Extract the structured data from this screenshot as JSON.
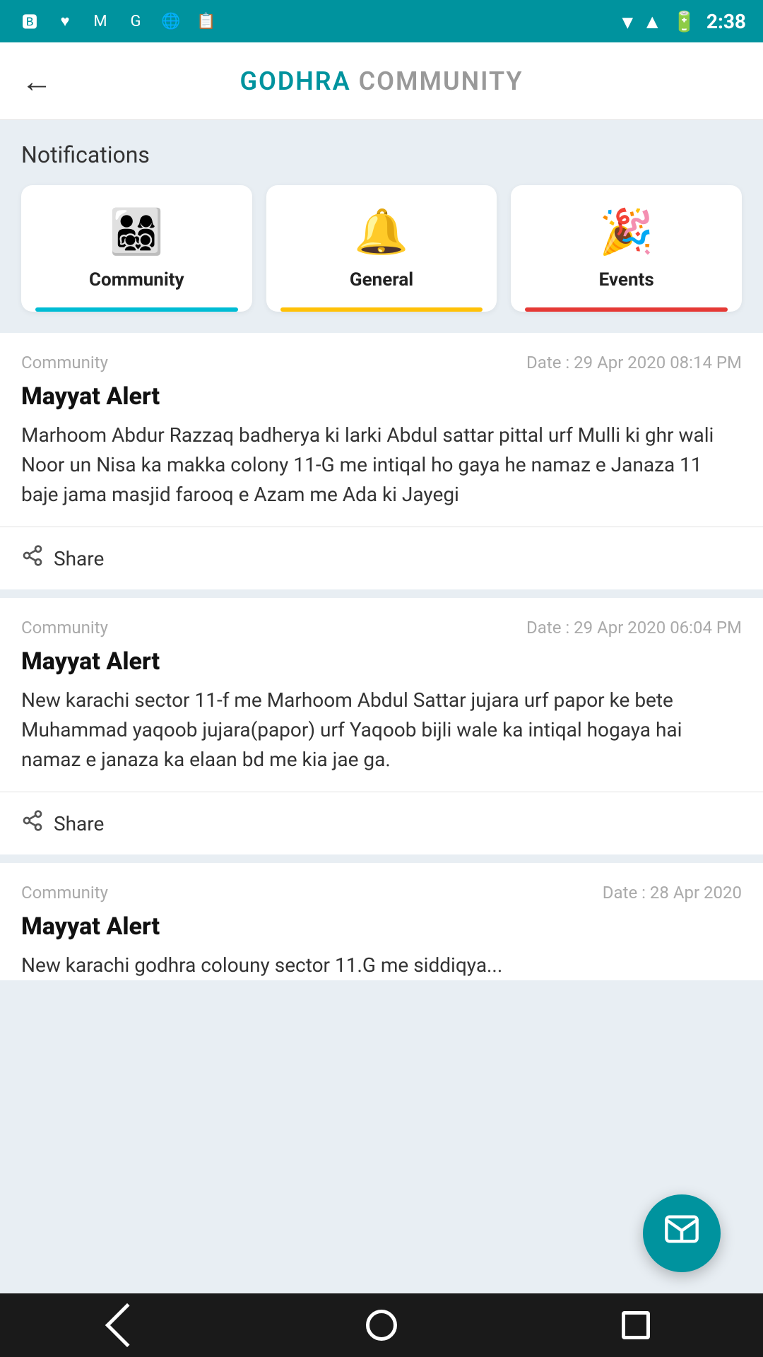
{
  "statusBar": {
    "time": "2:38",
    "icons": [
      "battery",
      "signal",
      "wifi"
    ]
  },
  "header": {
    "brand": "GODHRA",
    "title": " COMMUNITY",
    "backLabel": "←"
  },
  "notifications": {
    "sectionLabel": "Notifications",
    "categories": [
      {
        "id": "community",
        "emoji": "👨‍👧‍👦",
        "label": "Community",
        "indicatorClass": "indicator-teal"
      },
      {
        "id": "general",
        "emoji": "🔔",
        "label": "General",
        "indicatorClass": "indicator-orange"
      },
      {
        "id": "events",
        "emoji": "🎉",
        "label": "Events",
        "indicatorClass": "indicator-red"
      }
    ],
    "items": [
      {
        "category": "Community",
        "date": "Date : 29 Apr 2020 08:14 PM",
        "title": "Mayyat Alert",
        "body": "Marhoom Abdur Razzaq badherya ki larki Abdul sattar pittal urf Mulli ki ghr wali Noor un Nisa ka makka colony 11-G me intiqal ho gaya he namaz e Janaza  11 baje jama masjid farooq e Azam me Ada ki Jayegi",
        "shareLabel": "Share"
      },
      {
        "category": "Community",
        "date": "Date : 29 Apr 2020 06:04 PM",
        "title": "Mayyat Alert",
        "body": " New karachi sector 11-f me Marhoom Abdul Sattar jujara urf papor ke bete Muhammad yaqoob jujara(papor) urf Yaqoob bijli wale ka intiqal hogaya hai namaz e janaza ka elaan bd me kia jae ga.",
        "shareLabel": "Share"
      },
      {
        "category": "Community",
        "date": "Date : 28 Apr 2020",
        "title": "Mayyat Alert",
        "body": "New karachi godhra colouny sector 11.G me siddiqya...",
        "shareLabel": "Share"
      }
    ]
  },
  "fab": {
    "icon": "✉",
    "label": "compose"
  },
  "bottomNav": {
    "back": "back",
    "home": "home",
    "recent": "recent"
  }
}
